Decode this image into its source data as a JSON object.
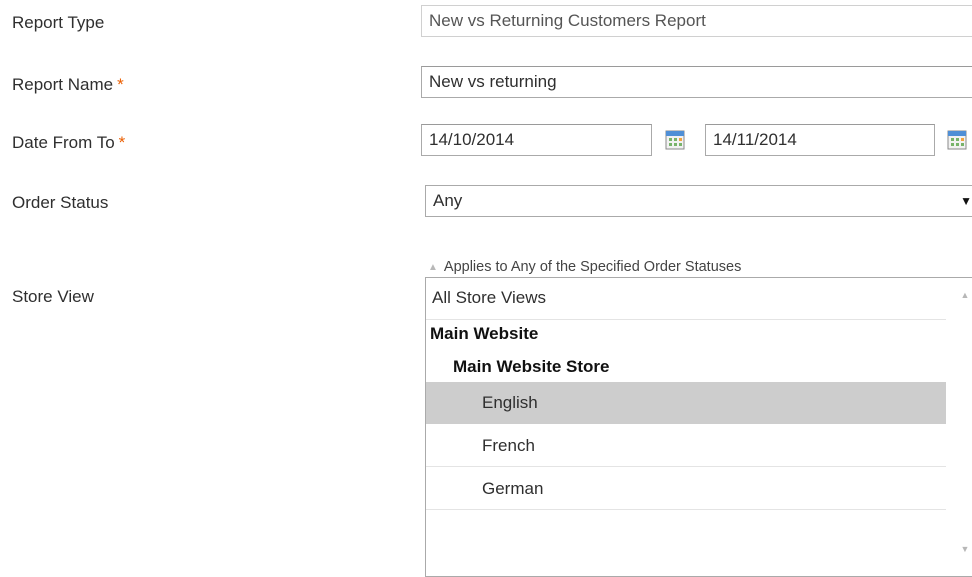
{
  "form": {
    "report_type": {
      "label": "Report Type",
      "value": "New vs Returning Customers Report"
    },
    "report_name": {
      "label": "Report Name",
      "required_mark": "*",
      "value": "New vs returning"
    },
    "date_range": {
      "label": "Date From To",
      "required_mark": "*",
      "from": "14/10/2014",
      "to": "14/11/2014",
      "icon": "calendar-icon"
    },
    "order_status": {
      "label": "Order Status",
      "selected": "Any",
      "note": "Applies to Any of the Specified Order Statuses",
      "icon": "dropdown-arrow-icon"
    },
    "store_view": {
      "label": "Store View",
      "options": {
        "all": "All Store Views",
        "website": "Main Website",
        "store": "Main Website Store",
        "english": "English",
        "french": "French",
        "german": "German"
      },
      "selected": "English"
    }
  },
  "colors": {
    "required": "#eb5e00",
    "selected_option_bg": "#cdcdcd",
    "border": "#aaaaaa"
  }
}
